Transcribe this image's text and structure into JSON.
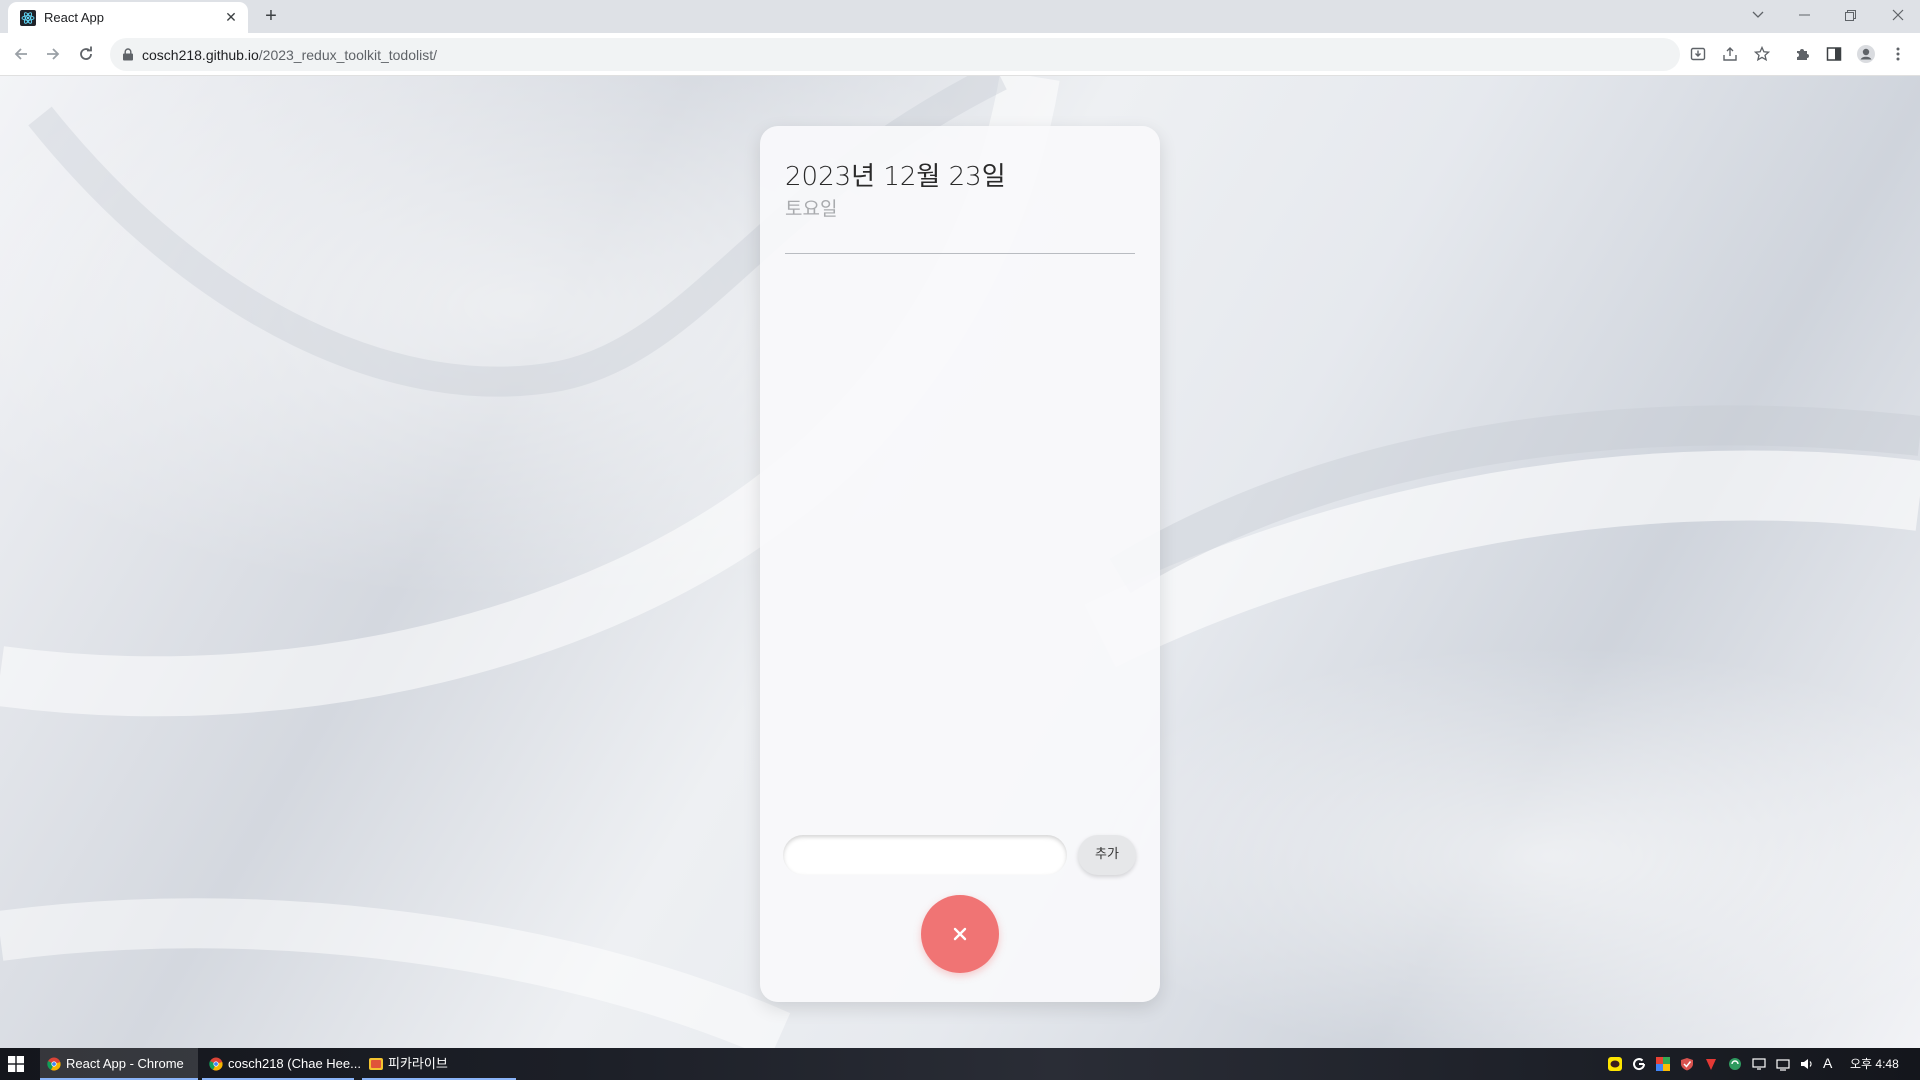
{
  "browser": {
    "tab": {
      "title": "React App",
      "close_icon": "close-icon"
    },
    "new_tab_icon": "plus-icon",
    "url_host": "cosch218.github.io",
    "url_path": "/2023_redux_toolkit_todolist/"
  },
  "app": {
    "date": "2023년 12월 23일",
    "weekday": "토요일",
    "input_value": "",
    "add_label": "추가",
    "close_icon": "close-icon",
    "accent_color": "#f07474"
  },
  "taskbar": {
    "items": [
      {
        "label": "React App - Chrome"
      },
      {
        "label": "cosch218 (Chae Hee..."
      },
      {
        "label": "피카라이브"
      }
    ],
    "time": "오후 4:48",
    "ime": "A"
  }
}
